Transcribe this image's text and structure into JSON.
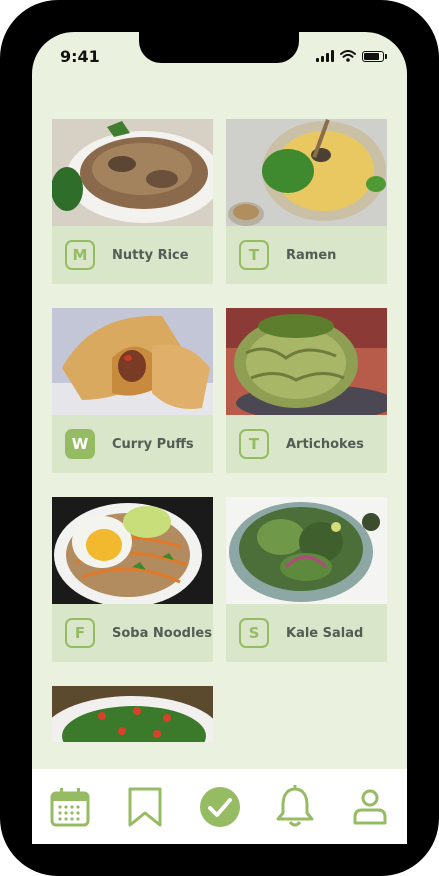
{
  "status": {
    "time": "9:41"
  },
  "recipes": [
    {
      "day": "M",
      "name": "Nutty Rice",
      "active": false
    },
    {
      "day": "T",
      "name": "Ramen",
      "active": false
    },
    {
      "day": "W",
      "name": "Curry Puffs",
      "active": true
    },
    {
      "day": "T",
      "name": "Artichokes",
      "active": false
    },
    {
      "day": "F",
      "name": "Soba Noodles",
      "active": false
    },
    {
      "day": "S",
      "name": "Kale Salad",
      "active": false
    }
  ],
  "tabbar": {
    "icons": [
      "calendar-icon",
      "bookmark-icon",
      "check-circle-icon",
      "bell-icon",
      "user-icon"
    ],
    "accent": "#96bc63"
  },
  "colors": {
    "background": "#eaf1df",
    "card": "#d9e6c9",
    "accent": "#96bc63",
    "text": "#555c55"
  }
}
